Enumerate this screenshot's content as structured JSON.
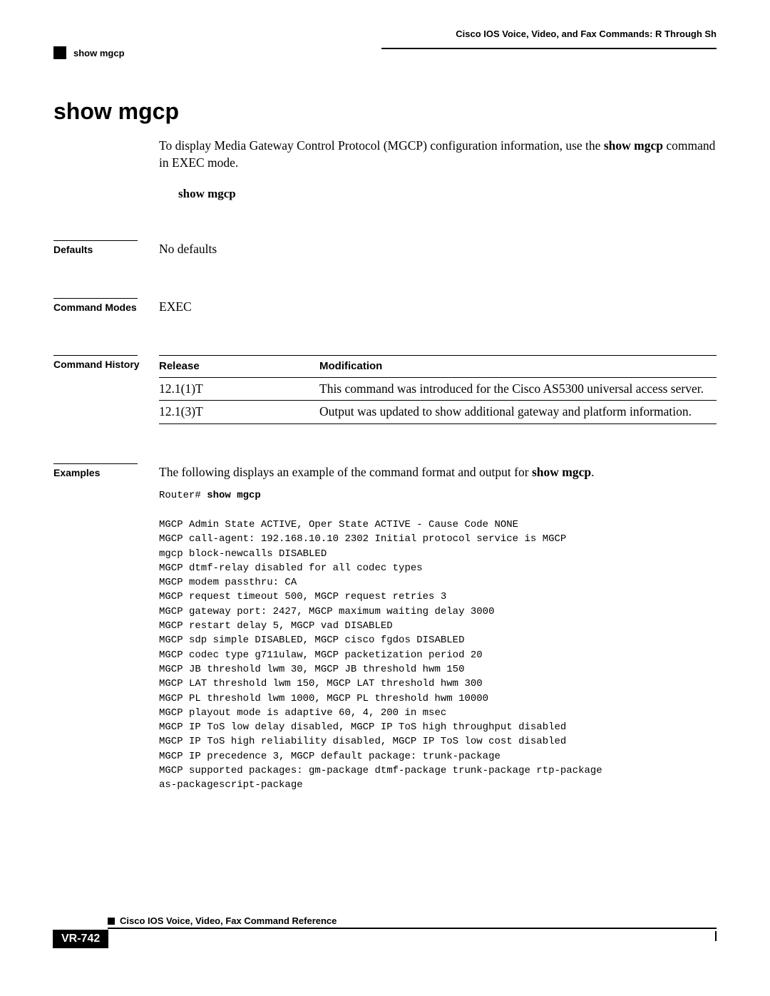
{
  "header": {
    "chapter_title": "Cisco IOS Voice, Video, and Fax Commands: R Through Sh",
    "cmd": "show mgcp"
  },
  "title": "show mgcp",
  "intro": {
    "text_pre": "To display Media Gateway Control Protocol (MGCP) configuration information, use the ",
    "cmd_bold": "show mgcp",
    "text_post": " command in EXEC mode."
  },
  "syntax": "show mgcp",
  "defaults": {
    "label": "Defaults",
    "value": "No defaults"
  },
  "modes": {
    "label": "Command Modes",
    "value": "EXEC"
  },
  "history": {
    "label": "Command History",
    "col1": "Release",
    "col2": "Modification",
    "rows": [
      {
        "release": "12.1(1)T",
        "mod": "This command was introduced for the Cisco AS5300 universal access server."
      },
      {
        "release": "12.1(3)T",
        "mod": "Output was updated to show additional gateway and platform information."
      }
    ]
  },
  "examples": {
    "label": "Examples",
    "intro_pre": "The following displays an example of the command format and output for ",
    "intro_bold": "show mgcp",
    "intro_post": ".",
    "prompt": "Router# ",
    "prompt_cmd": "show mgcp",
    "output": "MGCP Admin State ACTIVE, Oper State ACTIVE - Cause Code NONE\nMGCP call-agent: 192.168.10.10 2302 Initial protocol service is MGCP\nmgcp block-newcalls DISABLED\nMGCP dtmf-relay disabled for all codec types\nMGCP modem passthru: CA\nMGCP request timeout 500, MGCP request retries 3\nMGCP gateway port: 2427, MGCP maximum waiting delay 3000\nMGCP restart delay 5, MGCP vad DISABLED\nMGCP sdp simple DISABLED, MGCP cisco fgdos DISABLED\nMGCP codec type g711ulaw, MGCP packetization period 20\nMGCP JB threshold lwm 30, MGCP JB threshold hwm 150\nMGCP LAT threshold lwm 150, MGCP LAT threshold hwm 300\nMGCP PL threshold lwm 1000, MGCP PL threshold hwm 10000\nMGCP playout mode is adaptive 60, 4, 200 in msec\nMGCP IP ToS low delay disabled, MGCP IP ToS high throughput disabled\nMGCP IP ToS high reliability disabled, MGCP IP ToS low cost disabled\nMGCP IP precedence 3, MGCP default package: trunk-package\nMGCP supported packages: gm-package dtmf-package trunk-package rtp-package \nas-packagescript-package"
  },
  "footer": {
    "doc_title": "Cisco IOS Voice, Video, Fax Command Reference",
    "page_num": "VR-742"
  }
}
